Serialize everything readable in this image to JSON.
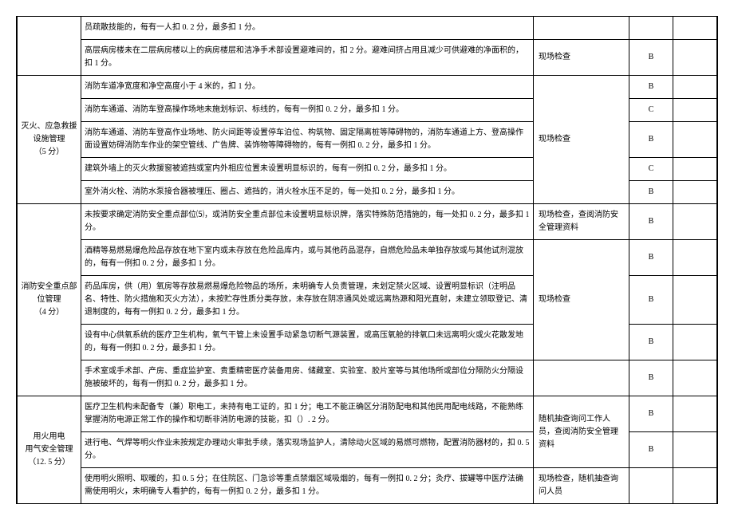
{
  "sections": [
    {
      "category": "",
      "rows": [
        {
          "desc": "员疏散技能的，每有一人扣 0. 2 分，最多扣 1 分。",
          "method": "",
          "score": "",
          "catRowspan": 0,
          "methodRowspan": 0,
          "scoreRowspan": 0
        },
        {
          "desc": "高层病房楼未在二层病房楼以上的病房楼层和洁净手术部设置避难间的，扣 2 分。避难间挤占用且减少可供避难的净面积的，扣 1 分。",
          "method": "现场检查",
          "score": "B",
          "catRowspan": 0,
          "methodRowspan": 1,
          "scoreRowspan": 1
        }
      ]
    },
    {
      "category": "灭火、应急救援\n设施管理\n（5 分）",
      "rows": [
        {
          "desc": "消防车道净宽度和净空高度小于 4 米的，扣 1 分。",
          "method": "现场检查",
          "score": "B",
          "catRowspan": 5,
          "methodRowspan": 5,
          "scoreRowspan": 1
        },
        {
          "desc": "消防车通道、消防车登高操作场地未施划标识、标线的，每有一例扣 0. 2 分，最多扣 1 分。",
          "method": "",
          "score": "C",
          "catRowspan": 0,
          "methodRowspan": 0,
          "scoreRowspan": 1
        },
        {
          "desc": "消防车通道、消防车登高作业场地、防火间距等设置停车泊位、构筑物、固定隔离桩等障碍物的，消防车通道上方、登高操作面设置妨碍消防车作业的架空管线、广告牌、装饰物等障碍物的，每有一例扣 0. 2 分，最多扣 1 分。",
          "method": "",
          "score": "B",
          "catRowspan": 0,
          "methodRowspan": 0,
          "scoreRowspan": 1
        },
        {
          "desc": "建筑外墙上的灭火救援窗被遮挡或室内外相应位置未设置明显标识的，每有一例扣 0. 2 分，最多扣 1 分。",
          "method": "",
          "score": "C",
          "catRowspan": 0,
          "methodRowspan": 0,
          "scoreRowspan": 1
        },
        {
          "desc": "室外消火栓、消防水泵接合器被埋压、圈占、遮挡的，消火栓水压不足的，每一处扣 0. 2 分，最多扣 1 分。",
          "method": "",
          "score": "B",
          "catRowspan": 0,
          "methodRowspan": 0,
          "scoreRowspan": 1
        }
      ]
    },
    {
      "category": "消防安全重点部\n位管理\n（4 分）",
      "rows": [
        {
          "desc": "未按要求确定消防安全重点部位⑸，或消防安全重点部位未设置明显标识牌，落实特殊防范措施的，每一处扣 0. 2 分，最多扣 1 分。",
          "method": "现场检查，查阅消防安全管理资料",
          "score": "B",
          "catRowspan": 4,
          "methodRowspan": 1,
          "scoreRowspan": 1
        },
        {
          "desc": "酒精等易燃易爆危险品存放在地下室内或未存放在危险品库内，或与其他药品混存，自燃危险品未单独存放或与其他试剂混放的，每有一例扣 0. 2 分，最多扣 1 分。",
          "method": "现场检查",
          "score": "B",
          "catRowspan": 0,
          "methodRowspan": 3,
          "scoreRowspan": 1
        },
        {
          "desc": "药品库房，供（用）氧房等存放易燃易爆危险物品的场所，未明确专人负责管理，未划定禁火区域、设置明显标识（注明品名、特性、防火措施和灭火方法），未按贮存性质分类存放，未存放在阴凉通风处或远离热源和阳光直射，未建立领取登记、清退制度的，每有一例扣 0. 2 分，最多扣 1 分。",
          "method": "",
          "score": "B",
          "catRowspan": 0,
          "methodRowspan": 0,
          "scoreRowspan": 1
        },
        {
          "desc": "设有中心供氧系统的医疗卫生机构，氧气干管上未设置手动紧急切断气源装置，或高压氧舱的排氧口未远离明火或火花散发地的，每有一例扣 0. 2 分，最多扣 1 分。",
          "method": "",
          "score": "B",
          "catRowspan": 0,
          "methodRowspan": 0,
          "scoreRowspan": 1
        },
        {
          "desc": "手术室或手术部、产房、重症监护室、贵重精密医疗装备用房、储藏室、实验室、胶片室等与其他场所或部位分隔防火分隔设施被破坏的，每有一例扣 0. 2 分，最多扣 1 分。",
          "method": "",
          "score": "B",
          "catRowspan": 1,
          "methodRowspan": 1,
          "scoreRowspan": 1
        }
      ]
    },
    {
      "category": "用火用电\n用气安全管理\n（12. 5 分）",
      "rows": [
        {
          "desc": "医疗卫生机构未配备专（兼）职电工，未持有电工证的，扣 1 分；电工不能正确区分消防配电和其他民用配电线路，不能熟练掌握消防电源正常工作的操作和切断非消防电源的技能，扣（）. 2 分。",
          "method": "随机抽查询问工作人员，查阅消防安全管理资料",
          "score": "B",
          "catRowspan": 3,
          "methodRowspan": 2,
          "scoreRowspan": 1
        },
        {
          "desc": "进行电、气焊等明火作业未按规定办理动火审批手续，落实现场监护人，清除动火区域的易燃可燃物，配置消防器材的，扣 0. 5 分。",
          "method": "",
          "score": "B",
          "catRowspan": 0,
          "methodRowspan": 0,
          "scoreRowspan": 1
        },
        {
          "desc": "使用明火照明、取暖的，扣 0. 5 分；在住院区、门急诊等重点禁烟区域吸烟的，每有一例扣 0. 2 分；灸疗、拔罐等中医疗法确需使用明火，未明确专人看护的，每有一例扣 0. 2 分，最多扣 1 分。",
          "method": "现场检查，随机抽查询问人员",
          "score": "",
          "catRowspan": 0,
          "methodRowspan": 1,
          "scoreRowspan": 1
        }
      ]
    }
  ]
}
